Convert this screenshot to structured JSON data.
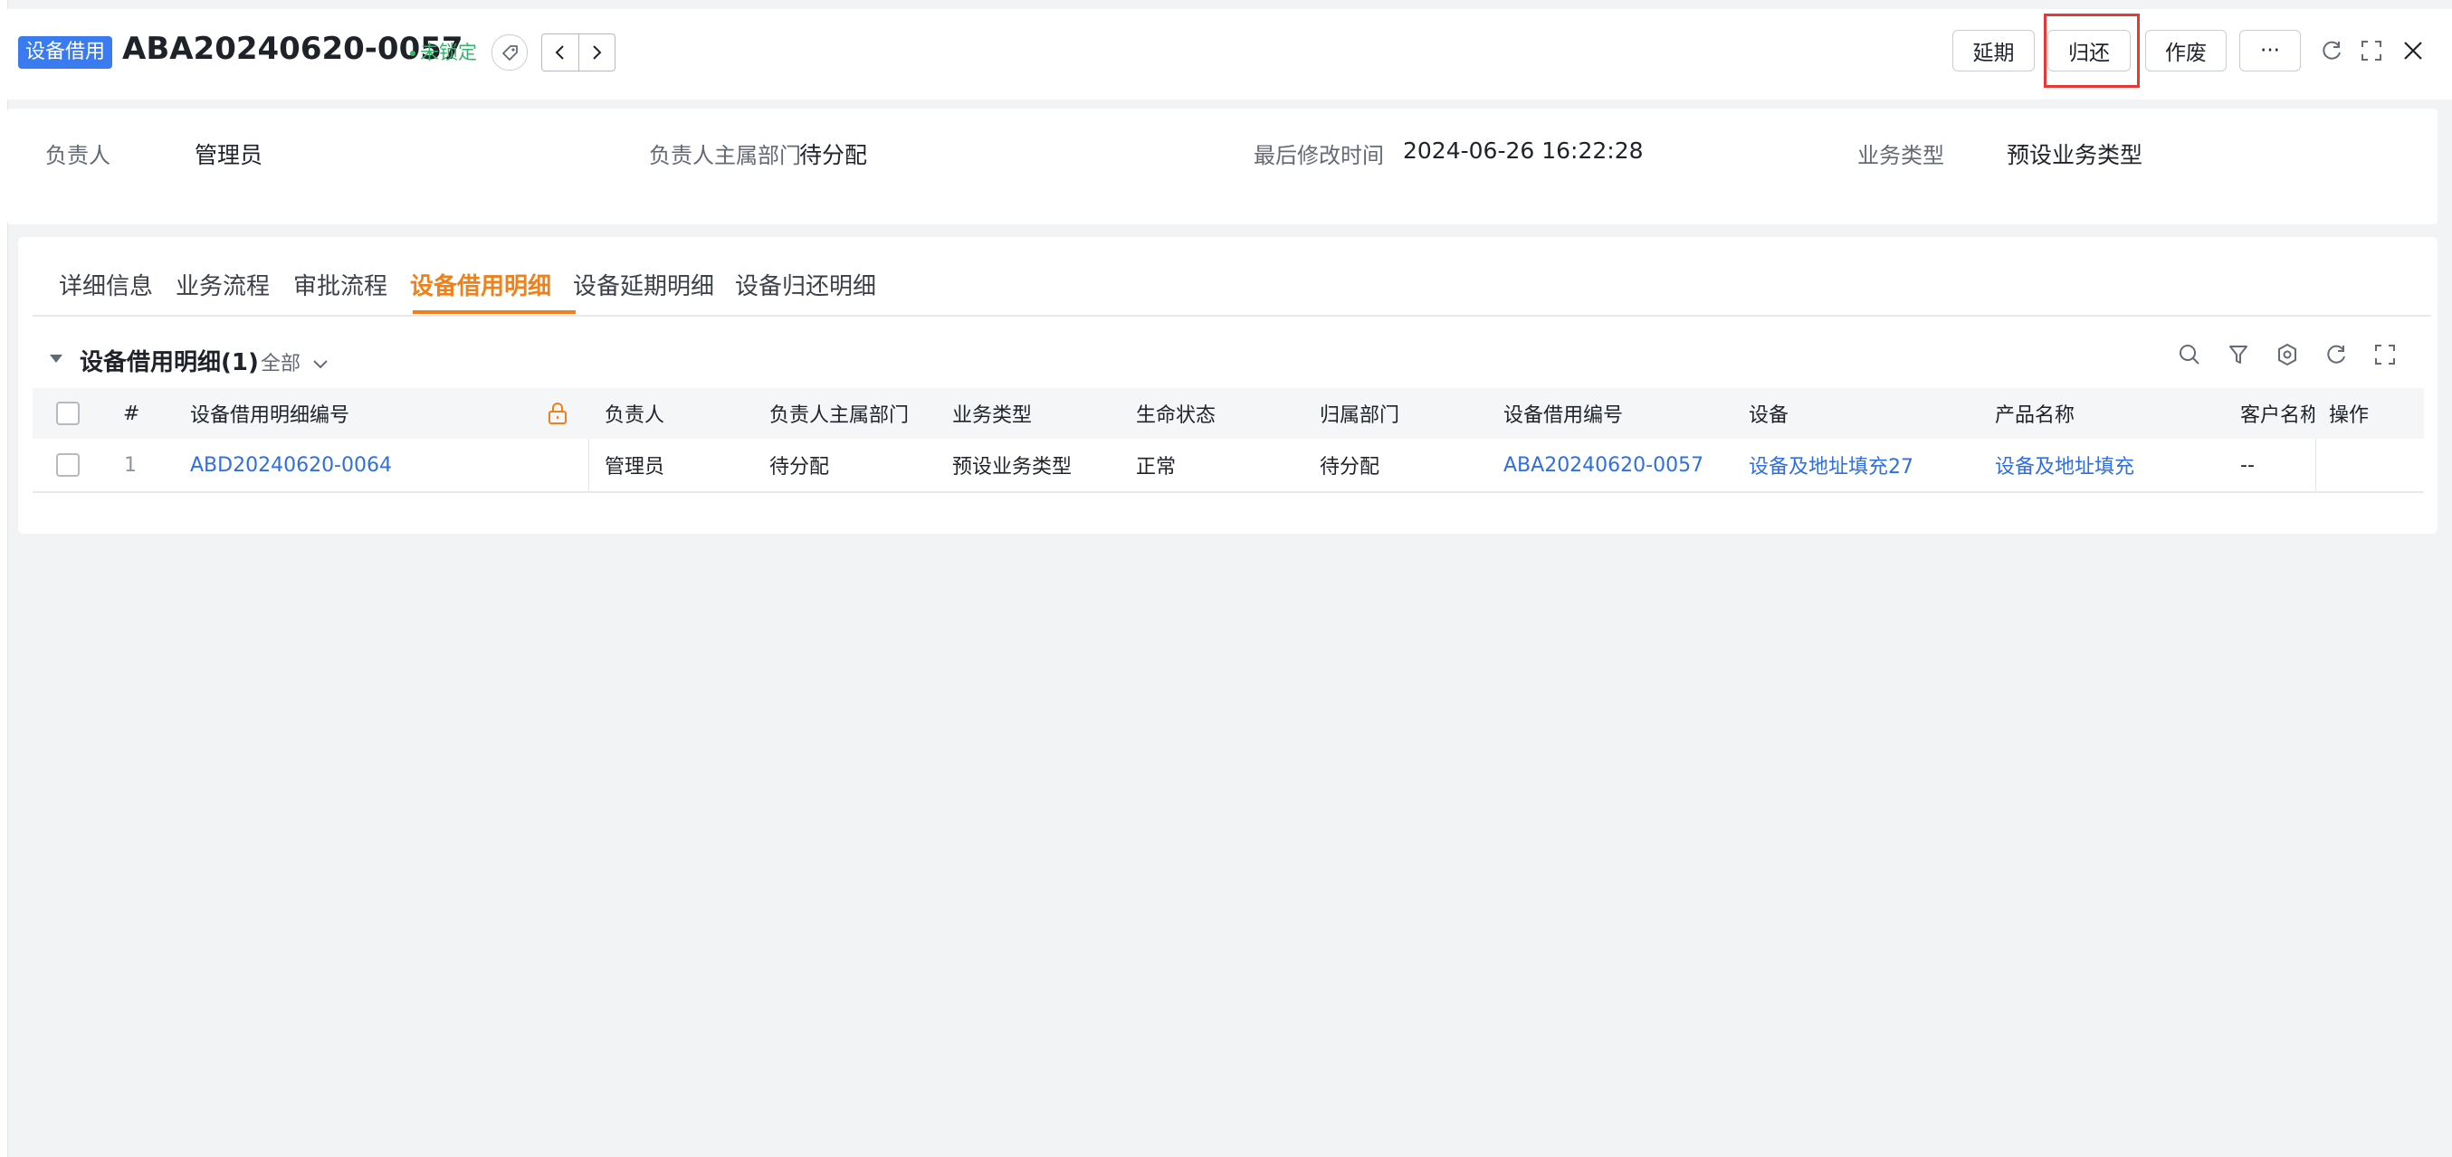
{
  "header": {
    "object_tag": "设备借用",
    "record_id": "ABA20240620-0057",
    "lock_status": "未锁定",
    "buttons": {
      "extend": "延期",
      "return": "归还",
      "void": "作废",
      "more": "···"
    }
  },
  "info": [
    {
      "label": "负责人",
      "value": "管理员"
    },
    {
      "label": "负责人主属部门",
      "value": "待分配"
    },
    {
      "label": "最后修改时间",
      "value": "2024-06-26 16:22:28"
    },
    {
      "label": "业务类型",
      "value": "预设业务类型"
    }
  ],
  "tabs": [
    "详细信息",
    "业务流程",
    "审批流程",
    "设备借用明细",
    "设备延期明细",
    "设备归还明细"
  ],
  "active_tab": "设备借用明细",
  "section": {
    "title": "设备借用明细(1)",
    "filter": "全部"
  },
  "table": {
    "columns": [
      "#",
      "设备借用明细编号",
      "负责人",
      "负责人主属部门",
      "业务类型",
      "生命状态",
      "归属部门",
      "设备借用编号",
      "设备",
      "产品名称",
      "客户名称",
      "操作"
    ],
    "rows": [
      {
        "index": "1",
        "detail_no": "ABD20240620-0064",
        "owner": "管理员",
        "owner_dept": "待分配",
        "biz_type": "预设业务类型",
        "life_status": "正常",
        "dept": "待分配",
        "borrow_no": "ABA20240620-0057",
        "device": "设备及地址填充27",
        "product": "设备及地址填充",
        "customer": "--",
        "action": ""
      }
    ]
  },
  "colors": {
    "accent": "#f0801a",
    "link": "#2f6fe0",
    "tag": "#3a7bf0",
    "status_ok": "#34b36a",
    "highlight": "#e53935"
  }
}
